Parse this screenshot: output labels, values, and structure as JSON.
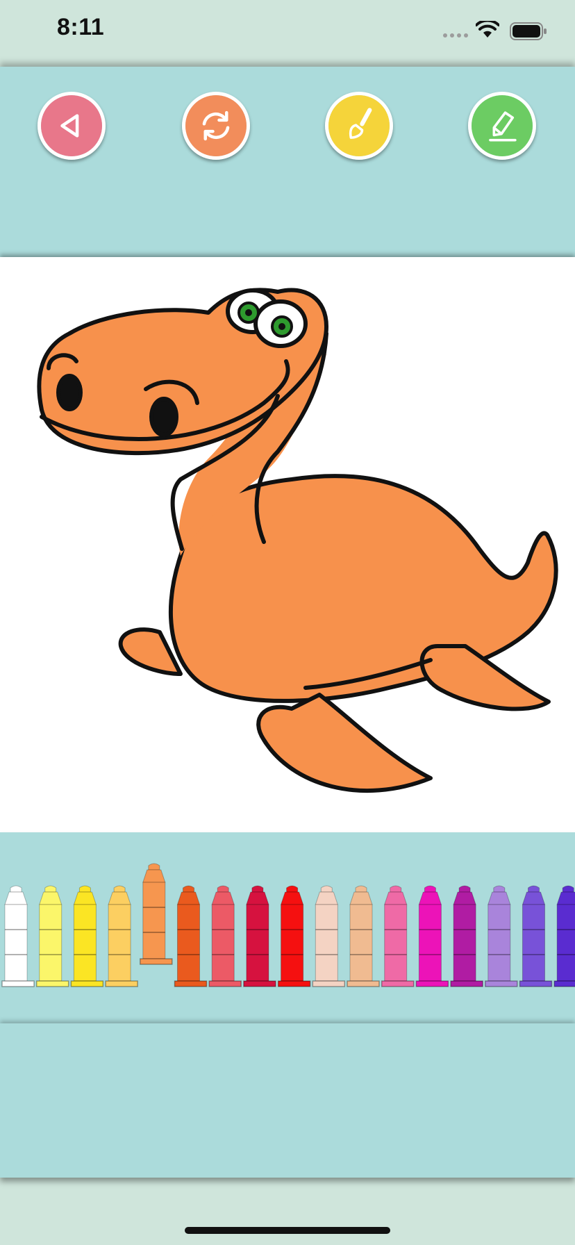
{
  "status_bar": {
    "time": "8:11"
  },
  "toolbar": {
    "buttons": [
      {
        "name": "back",
        "icon": "back-triangle-icon",
        "color": "#e8778a"
      },
      {
        "name": "reset",
        "icon": "refresh-icon",
        "color": "#f28d5b"
      },
      {
        "name": "brush",
        "icon": "paint-brush-icon",
        "color": "#f5d43a"
      },
      {
        "name": "pencil",
        "icon": "pencil-icon",
        "color": "#6ccc63"
      }
    ]
  },
  "canvas": {
    "subject": "dinosaur-drawing",
    "fill_color": "#f7914c",
    "eye_color": "#2e9b2e"
  },
  "palette": {
    "selected_index": 4,
    "colors": [
      "#ffffff",
      "#fbf66a",
      "#fbe524",
      "#fccf61",
      "#f6964f",
      "#ea5a1e",
      "#ec5a66",
      "#d6123f",
      "#f51010",
      "#f4d3c3",
      "#f0bb91",
      "#ef6aa6",
      "#ec13b8",
      "#b01ca3",
      "#a984db",
      "#7852d8",
      "#5a2cd0"
    ]
  }
}
